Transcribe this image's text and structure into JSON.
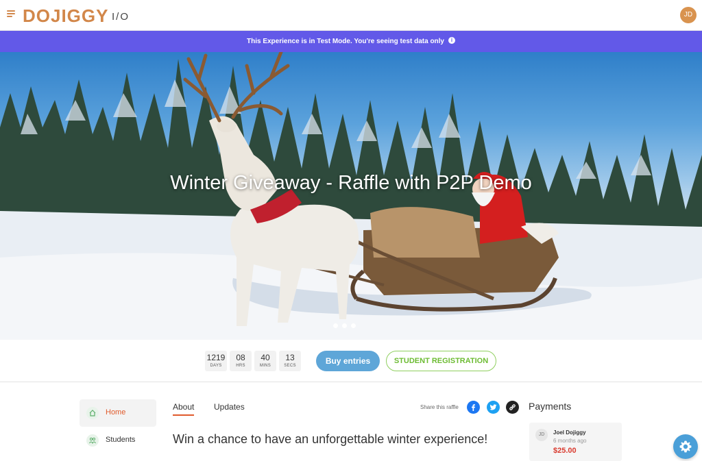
{
  "header": {
    "logo": "DOJIGGY",
    "logo_suffix": "I/O",
    "avatar_initials": "JD",
    "accent_color": "#d2874a"
  },
  "banner": {
    "text": "This Experience is in Test Mode. You're seeing test data only",
    "info_glyph": "i",
    "color": "#6259e8"
  },
  "hero": {
    "title": "Winter Giveaway - Raffle with P2P Demo",
    "slide_count": 3
  },
  "countdown": {
    "days": {
      "value": "1219",
      "label": "DAYS"
    },
    "hrs": {
      "value": "08",
      "label": "HRS"
    },
    "mins": {
      "value": "40",
      "label": "MINS"
    },
    "secs": {
      "value": "13",
      "label": "SECS"
    }
  },
  "actions": {
    "buy_label": "Buy entries",
    "register_label": "STUDENT REGISTRATION"
  },
  "sidebar": {
    "items": [
      {
        "label": "Home",
        "icon": "home-icon",
        "active": true
      },
      {
        "label": "Students",
        "icon": "students-icon",
        "active": false
      }
    ]
  },
  "tabs": [
    {
      "label": "About",
      "active": true
    },
    {
      "label": "Updates",
      "active": false
    }
  ],
  "share": {
    "label": "Share this raffle",
    "icons": [
      "facebook-icon",
      "twitter-icon",
      "link-icon"
    ]
  },
  "content": {
    "headline": "Win a chance to have an unforgettable winter experience!"
  },
  "payments": {
    "title": "Payments",
    "items": [
      {
        "initials": "JD",
        "name": "Joel Dojiggy",
        "time": "6 months ago",
        "amount": "$25.00"
      }
    ]
  }
}
